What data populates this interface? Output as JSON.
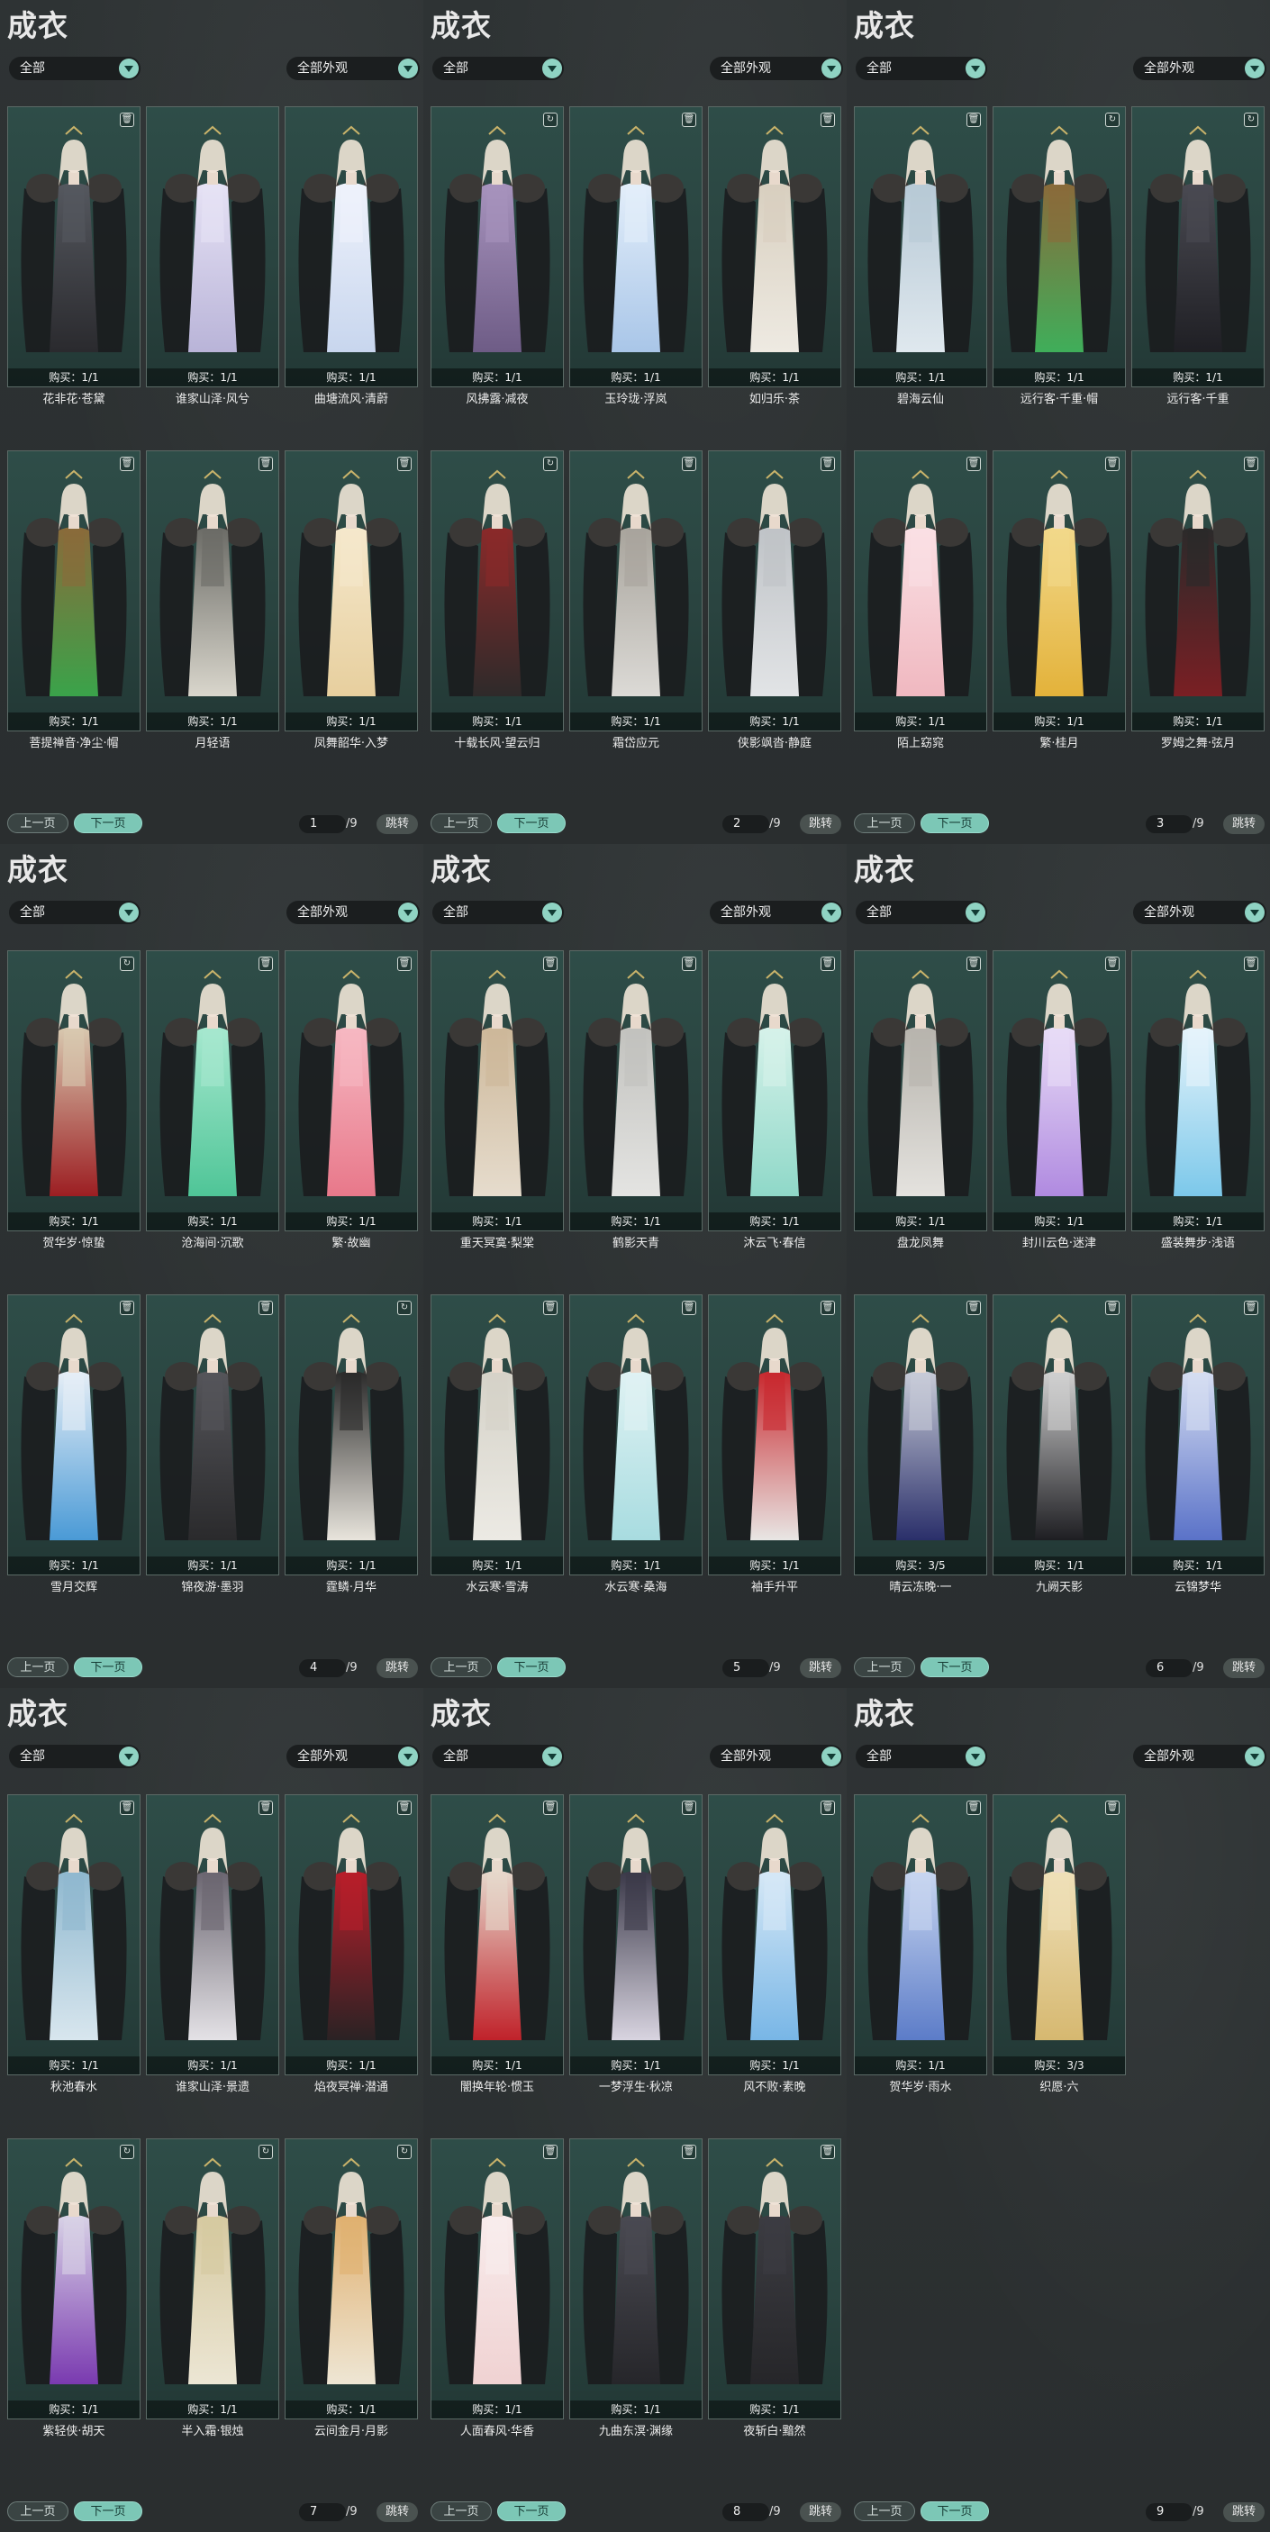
{
  "colors": {
    "background": "#2b2f30",
    "card": "#2a4440",
    "accent": "#7cc7b6"
  },
  "panels": [
    {
      "title": "成衣",
      "filter1": "全部",
      "filter2": "全部外观",
      "prev": "上一页",
      "next": "下一页",
      "page": "1",
      "total": "/9",
      "jump": "跳转",
      "items": [
        {
          "name": "花非花·苍黛",
          "buy": "购买：1/1",
          "badge": "trash-icon",
          "dress": "#2a2a2e",
          "dress2": "#55585f"
        },
        {
          "name": "谁家山泽·风兮",
          "buy": "购买：1/1",
          "badge": "",
          "dress": "#b9b4d8",
          "dress2": "#e6e2f5"
        },
        {
          "name": "曲塘流风·清蔚",
          "buy": "购买：1/1",
          "badge": "",
          "dress": "#c8d6ee",
          "dress2": "#eef2fb"
        },
        {
          "name": "菩提禅音·净尘·帽",
          "buy": "购买：1/1",
          "badge": "trash-icon",
          "dress": "#3aa34a",
          "dress2": "#8a6a3a"
        },
        {
          "name": "月轻语",
          "buy": "购买：1/1",
          "badge": "trash-icon",
          "dress": "#d9d6cc",
          "dress2": "#6b6b66"
        },
        {
          "name": "凤舞韶华·入梦",
          "buy": "购买：1/1",
          "badge": "trash-icon",
          "dress": "#e7cf9e",
          "dress2": "#f5e8cc"
        }
      ]
    },
    {
      "title": "成衣",
      "filter1": "全部",
      "filter2": "全部外观",
      "prev": "上一页",
      "next": "下一页",
      "page": "2",
      "total": "/9",
      "jump": "跳转",
      "items": [
        {
          "name": "风拂露·减夜",
          "buy": "购买：1/1",
          "badge": "recycle-icon",
          "dress": "#6e5c86",
          "dress2": "#a793bd"
        },
        {
          "name": "玉玲珑·浮岚",
          "buy": "购买：1/1",
          "badge": "trash-icon",
          "dress": "#a9c6e8",
          "dress2": "#e3eefa"
        },
        {
          "name": "如归乐·茶",
          "buy": "购买：1/1",
          "badge": "trash-icon",
          "dress": "#eeeae2",
          "dress2": "#d8cfbf"
        },
        {
          "name": "十载长风·望云归",
          "buy": "购买：1/1",
          "badge": "recycle-icon",
          "dress": "#2e2a2a",
          "dress2": "#8a2a2a"
        },
        {
          "name": "霜岱应元",
          "buy": "购买：1/1",
          "badge": "trash-icon",
          "dress": "#dcdad6",
          "dress2": "#a8a49c"
        },
        {
          "name": "侠影飒沓·静庭",
          "buy": "购买：1/1",
          "badge": "trash-icon",
          "dress": "#e2e4e6",
          "dress2": "#bfc3c7"
        }
      ]
    },
    {
      "title": "成衣",
      "filter1": "全部",
      "filter2": "全部外观",
      "prev": "上一页",
      "next": "下一页",
      "page": "3",
      "total": "/9",
      "jump": "跳转",
      "items": [
        {
          "name": "碧海云仙",
          "buy": "购买：1/1",
          "badge": "trash-icon",
          "dress": "#dfe8ee",
          "dress2": "#b7c9d6"
        },
        {
          "name": "远行客·千重·帽",
          "buy": "购买：1/1",
          "badge": "recycle-icon",
          "dress": "#3fae5a",
          "dress2": "#8a6a3a"
        },
        {
          "name": "远行客·千重",
          "buy": "购买：1/1",
          "badge": "recycle-icon",
          "dress": "#1f1f24",
          "dress2": "#4a4a52"
        },
        {
          "name": "陌上窈窕",
          "buy": "购买：1/1",
          "badge": "trash-icon",
          "dress": "#f0b8c0",
          "dress2": "#fae0e4"
        },
        {
          "name": "繁·桂月",
          "buy": "购买：1/1",
          "badge": "trash-icon",
          "dress": "#e3b23a",
          "dress2": "#f2d88a"
        },
        {
          "name": "罗姆之舞·弦月",
          "buy": "购买：1/1",
          "badge": "trash-icon",
          "dress": "#7a1f24",
          "dress2": "#2a2a2a"
        }
      ]
    },
    {
      "title": "成衣",
      "filter1": "全部",
      "filter2": "全部外观",
      "prev": "上一页",
      "next": "下一页",
      "page": "4",
      "total": "/9",
      "jump": "跳转",
      "items": [
        {
          "name": "贺华岁·惊蛰",
          "buy": "购买：1/1",
          "badge": "recycle-icon",
          "dress": "#9c1e22",
          "dress2": "#d8c9b0"
        },
        {
          "name": "沧海间·沉歌",
          "buy": "购买：1/1",
          "badge": "trash-icon",
          "dress": "#4fc597",
          "dress2": "#a6e8cf"
        },
        {
          "name": "繁·故幽",
          "buy": "购买：1/1",
          "badge": "trash-icon",
          "dress": "#e8788a",
          "dress2": "#f6b8c2"
        },
        {
          "name": "雪月交辉",
          "buy": "购买：1/1",
          "badge": "trash-icon",
          "dress": "#4a9ad6",
          "dress2": "#e6eef6"
        },
        {
          "name": "锦夜游·墨羽",
          "buy": "购买：1/1",
          "badge": "trash-icon",
          "dress": "#2a2a2c",
          "dress2": "#55555a"
        },
        {
          "name": "霆鳞·月华",
          "buy": "购买：1/1",
          "badge": "recycle-icon",
          "dress": "#e8e4dc",
          "dress2": "#2a2a2a"
        }
      ]
    },
    {
      "title": "成衣",
      "filter1": "全部",
      "filter2": "全部外观",
      "prev": "上一页",
      "next": "下一页",
      "page": "5",
      "total": "/9",
      "jump": "跳转",
      "items": [
        {
          "name": "重天冥寞·梨棠",
          "buy": "购买：1/1",
          "badge": "trash-icon",
          "dress": "#e6dccd",
          "dress2": "#cdb89a"
        },
        {
          "name": "鹤影天青",
          "buy": "购买：1/1",
          "badge": "trash-icon",
          "dress": "#e4e4e2",
          "dress2": "#c2c2be"
        },
        {
          "name": "沐云飞·春信",
          "buy": "购买：1/1",
          "badge": "trash-icon",
          "dress": "#8fd8c8",
          "dress2": "#d6f2ea"
        },
        {
          "name": "水云寒·雪涛",
          "buy": "购买：1/1",
          "badge": "trash-icon",
          "dress": "#eceae4",
          "dress2": "#d5d2c8"
        },
        {
          "name": "水云寒·桑海",
          "buy": "购买：1/1",
          "badge": "trash-icon",
          "dress": "#a8dce0",
          "dress2": "#dff2f3"
        },
        {
          "name": "袖手升平",
          "buy": "购买：1/1",
          "badge": "trash-icon",
          "dress": "#e8e6e4",
          "dress2": "#c8282e"
        }
      ]
    },
    {
      "title": "成衣",
      "filter1": "全部",
      "filter2": "全部外观",
      "prev": "上一页",
      "next": "下一页",
      "page": "6",
      "total": "/9",
      "jump": "跳转",
      "items": [
        {
          "name": "盘龙凤舞",
          "buy": "购买：1/1",
          "badge": "trash-icon",
          "dress": "#e4e2de",
          "dress2": "#b7b4ad"
        },
        {
          "name": "封川云色·迷津",
          "buy": "购买：1/1",
          "badge": "trash-icon",
          "dress": "#b08ae0",
          "dress2": "#e8dcf6"
        },
        {
          "name": "盛装舞步·浅语",
          "buy": "购买：1/1",
          "badge": "trash-icon",
          "dress": "#7cc8ea",
          "dress2": "#e6f4fb"
        },
        {
          "name": "晴云冻晚·一",
          "buy": "购买：3/5",
          "badge": "trash-icon",
          "dress": "#2a2f6a",
          "dress2": "#c8ccd8"
        },
        {
          "name": "九阙天影",
          "buy": "购买：1/1",
          "badge": "trash-icon",
          "dress": "#1e1e22",
          "dress2": "#d0d0d0"
        },
        {
          "name": "云锦梦华",
          "buy": "购买：1/1",
          "badge": "trash-icon",
          "dress": "#5a72c8",
          "dress2": "#d6def2"
        }
      ]
    },
    {
      "title": "成衣",
      "filter1": "全部",
      "filter2": "全部外观",
      "prev": "上一页",
      "next": "下一页",
      "page": "7",
      "total": "/9",
      "jump": "跳转",
      "items": [
        {
          "name": "秋池春水",
          "buy": "购买：1/1",
          "badge": "trash-icon",
          "dress": "#d8e6ee",
          "dress2": "#8fb8cf"
        },
        {
          "name": "谁家山泽·景遗",
          "buy": "购买：1/1",
          "badge": "trash-icon",
          "dress": "#e4e2e6",
          "dress2": "#6a6570"
        },
        {
          "name": "焰夜冥禅·潜通",
          "buy": "购买：1/1",
          "badge": "trash-icon",
          "dress": "#2a2224",
          "dress2": "#b81e2a"
        },
        {
          "name": "紫轻侠·胡天",
          "buy": "购买：1/1",
          "badge": "recycle-icon",
          "dress": "#7a3ab0",
          "dress2": "#d8d2e6"
        },
        {
          "name": "半入霜·银烛",
          "buy": "购买：1/1",
          "badge": "recycle-icon",
          "dress": "#ece6d4",
          "dress2": "#d6c9a0"
        },
        {
          "name": "云间金月·月影",
          "buy": "购买：1/1",
          "badge": "recycle-icon",
          "dress": "#eee6d4",
          "dress2": "#e0b070"
        }
      ]
    },
    {
      "title": "成衣",
      "filter1": "全部",
      "filter2": "全部外观",
      "prev": "上一页",
      "next": "下一页",
      "page": "8",
      "total": "/9",
      "jump": "跳转",
      "items": [
        {
          "name": "闇换年轮·惯玉",
          "buy": "购买：1/1",
          "badge": "trash-icon",
          "dress": "#c0222a",
          "dress2": "#e6d8cc"
        },
        {
          "name": "一梦浮生·秋凉",
          "buy": "购买：1/1",
          "badge": "trash-icon",
          "dress": "#d8d4e0",
          "dress2": "#3a3848"
        },
        {
          "name": "风不败·素晚",
          "buy": "购买：1/1",
          "badge": "trash-icon",
          "dress": "#78b6e6",
          "dress2": "#d6e8f6"
        },
        {
          "name": "人面春风·华香",
          "buy": "购买：1/1",
          "badge": "trash-icon",
          "dress": "#f0d2d2",
          "dress2": "#f8ecec"
        },
        {
          "name": "九曲东溟·渊缘",
          "buy": "购买：1/1",
          "badge": "trash-icon",
          "dress": "#26262a",
          "dress2": "#4a4a52"
        },
        {
          "name": "夜斩白·黯然",
          "buy": "购买：1/1",
          "badge": "trash-icon",
          "dress": "#262629",
          "dress2": "#3c3c42"
        }
      ]
    },
    {
      "title": "成衣",
      "filter1": "全部",
      "filter2": "全部外观",
      "prev": "上一页",
      "next": "下一页",
      "page": "9",
      "total": "/9",
      "jump": "跳转",
      "items": [
        {
          "name": "贺华岁·雨水",
          "buy": "购买：1/1",
          "badge": "trash-icon",
          "dress": "#5c7cc8",
          "dress2": "#c8d6f0"
        },
        {
          "name": "织愿·六",
          "buy": "购买：3/3",
          "badge": "trash-icon",
          "dress": "#d6b870",
          "dress2": "#efe0b8"
        }
      ]
    }
  ]
}
